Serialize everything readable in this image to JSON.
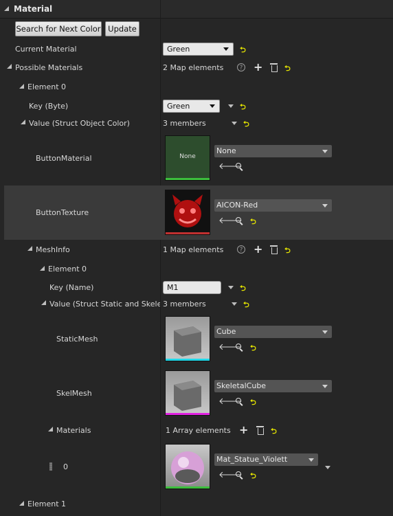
{
  "header": {
    "title": "Material"
  },
  "toolbar": {
    "search_next_color": "Search for Next Color",
    "update": "Update"
  },
  "current_material": {
    "label": "Current Material",
    "value": "Green"
  },
  "possible_materials": {
    "label": "Possible Materials",
    "count": "2 Map elements"
  },
  "element0": {
    "label": "Element 0",
    "key": {
      "label": "Key (Byte)",
      "value": "Green"
    },
    "value": {
      "label": "Value (Struct Object Color)",
      "members": "3 members"
    },
    "button_material": {
      "label": "ButtonMaterial",
      "thumb_text": "None",
      "asset": "None"
    },
    "button_texture": {
      "label": "ButtonTexture",
      "asset": "AICON-Red"
    },
    "mesh_info": {
      "label": "MeshInfo",
      "count": "1 Map elements",
      "element0": {
        "label": "Element 0",
        "key": {
          "label": "Key (Name)",
          "value": "M1"
        },
        "value": {
          "label": "Value (Struct Static and Skeleta",
          "members": "3 members"
        },
        "static_mesh": {
          "label": "StaticMesh",
          "asset": "Cube"
        },
        "skel_mesh": {
          "label": "SkelMesh",
          "asset": "SkeletalCube"
        },
        "materials": {
          "label": "Materials",
          "count": "1 Array elements",
          "index": "0",
          "asset": "Mat_Statue_Violett"
        }
      }
    }
  },
  "element1": {
    "label": "Element 1"
  },
  "colors": {
    "background": "#262626",
    "highlight_row": "#3a3a3a",
    "reset_arrow": "#e6e600"
  }
}
